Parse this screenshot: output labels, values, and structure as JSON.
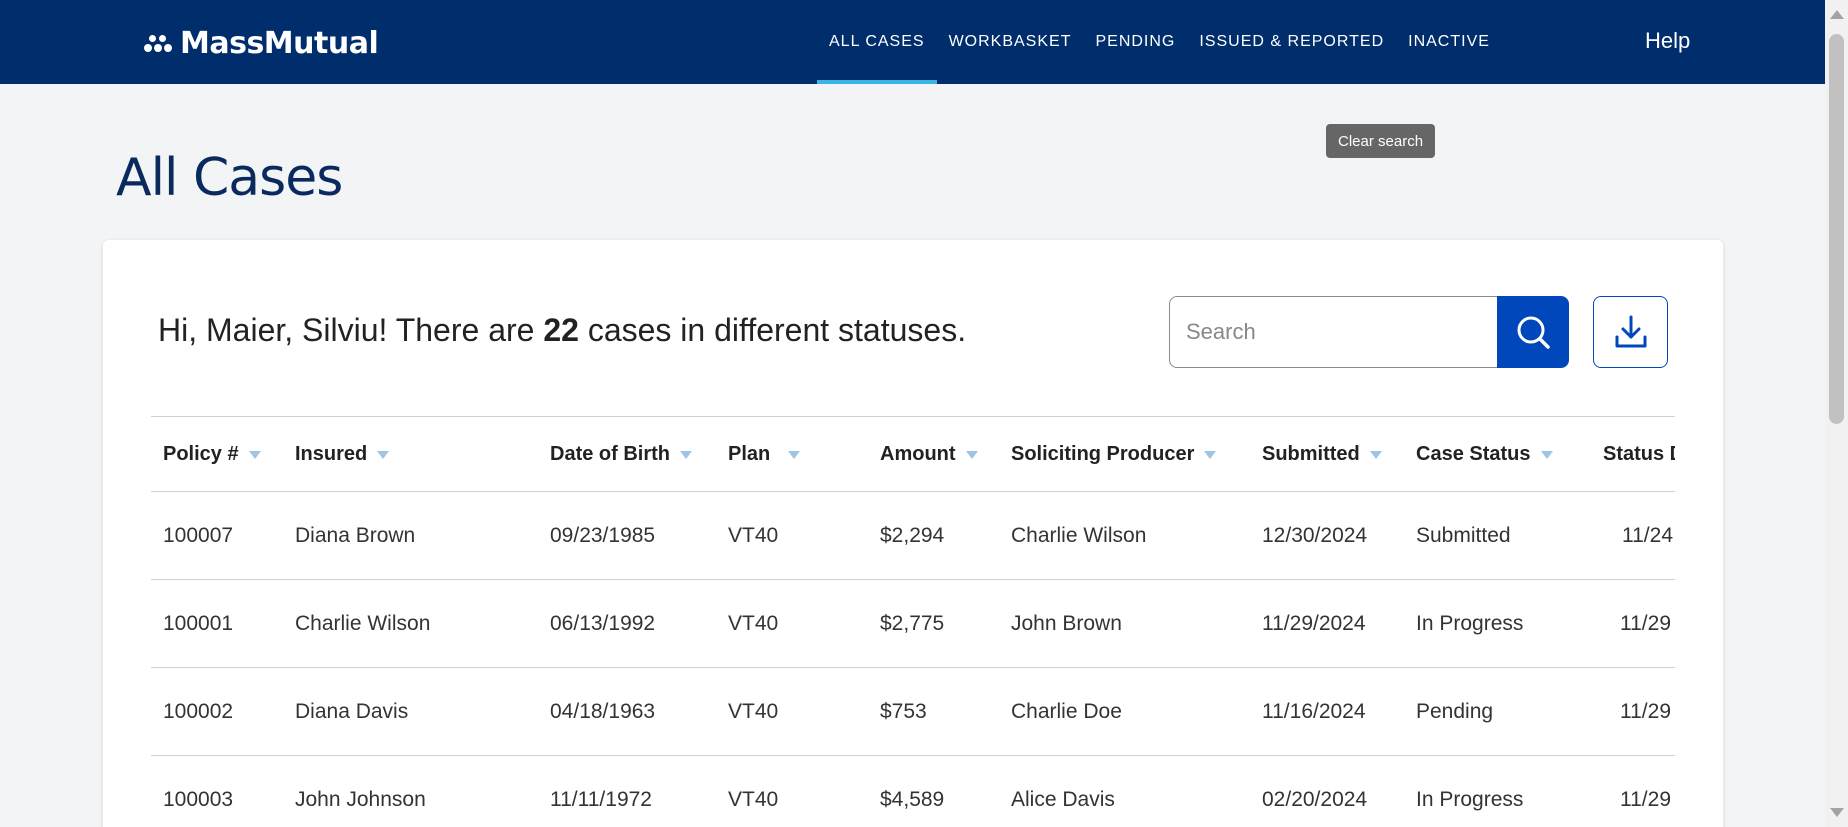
{
  "header": {
    "logo_text": "MassMutual",
    "nav": [
      {
        "label": "ALL CASES",
        "active": true
      },
      {
        "label": "WORKBASKET",
        "active": false
      },
      {
        "label": "PENDING",
        "active": false
      },
      {
        "label": "ISSUED & REPORTED",
        "active": false
      },
      {
        "label": "INACTIVE",
        "active": false
      }
    ],
    "help_label": "Help"
  },
  "page": {
    "title": "All Cases"
  },
  "card": {
    "greeting_prefix": "Hi, Maier, Silviu! There are ",
    "case_count": "22",
    "greeting_suffix": " cases in different statuses.",
    "search": {
      "placeholder": "Search",
      "value": ""
    },
    "tooltip": "Clear search",
    "icons": {
      "search": "search-icon",
      "download": "download-icon"
    }
  },
  "table": {
    "columns": [
      "Policy #",
      "Insured",
      "Date of Birth",
      "Plan",
      "Amount",
      "Soliciting Producer",
      "Submitted",
      "Case Status",
      "Status D"
    ],
    "rows": [
      [
        "100007",
        "Diana Brown",
        "09/23/1985",
        "VT40",
        "$2,294",
        "Charlie Wilson",
        "12/30/2024",
        "Submitted",
        "11/24"
      ],
      [
        "100001",
        "Charlie Wilson",
        "06/13/1992",
        "VT40",
        "$2,775",
        "John Brown",
        "11/29/2024",
        "In Progress",
        "11/29"
      ],
      [
        "100002",
        "Diana Davis",
        "04/18/1963",
        "VT40",
        "$753",
        "Charlie Doe",
        "11/16/2024",
        "Pending",
        "11/29"
      ],
      [
        "100003",
        "John Johnson",
        "11/11/1972",
        "VT40",
        "$4,589",
        "Alice Davis",
        "02/20/2024",
        "In Progress",
        "11/29"
      ]
    ]
  },
  "colors": {
    "nav_bg": "#002d6b",
    "nav_active_underline": "#3ab5e6",
    "primary_button": "#0047bb",
    "filter_icon": "#9ec4e8",
    "title_color": "#0a2a5e"
  }
}
